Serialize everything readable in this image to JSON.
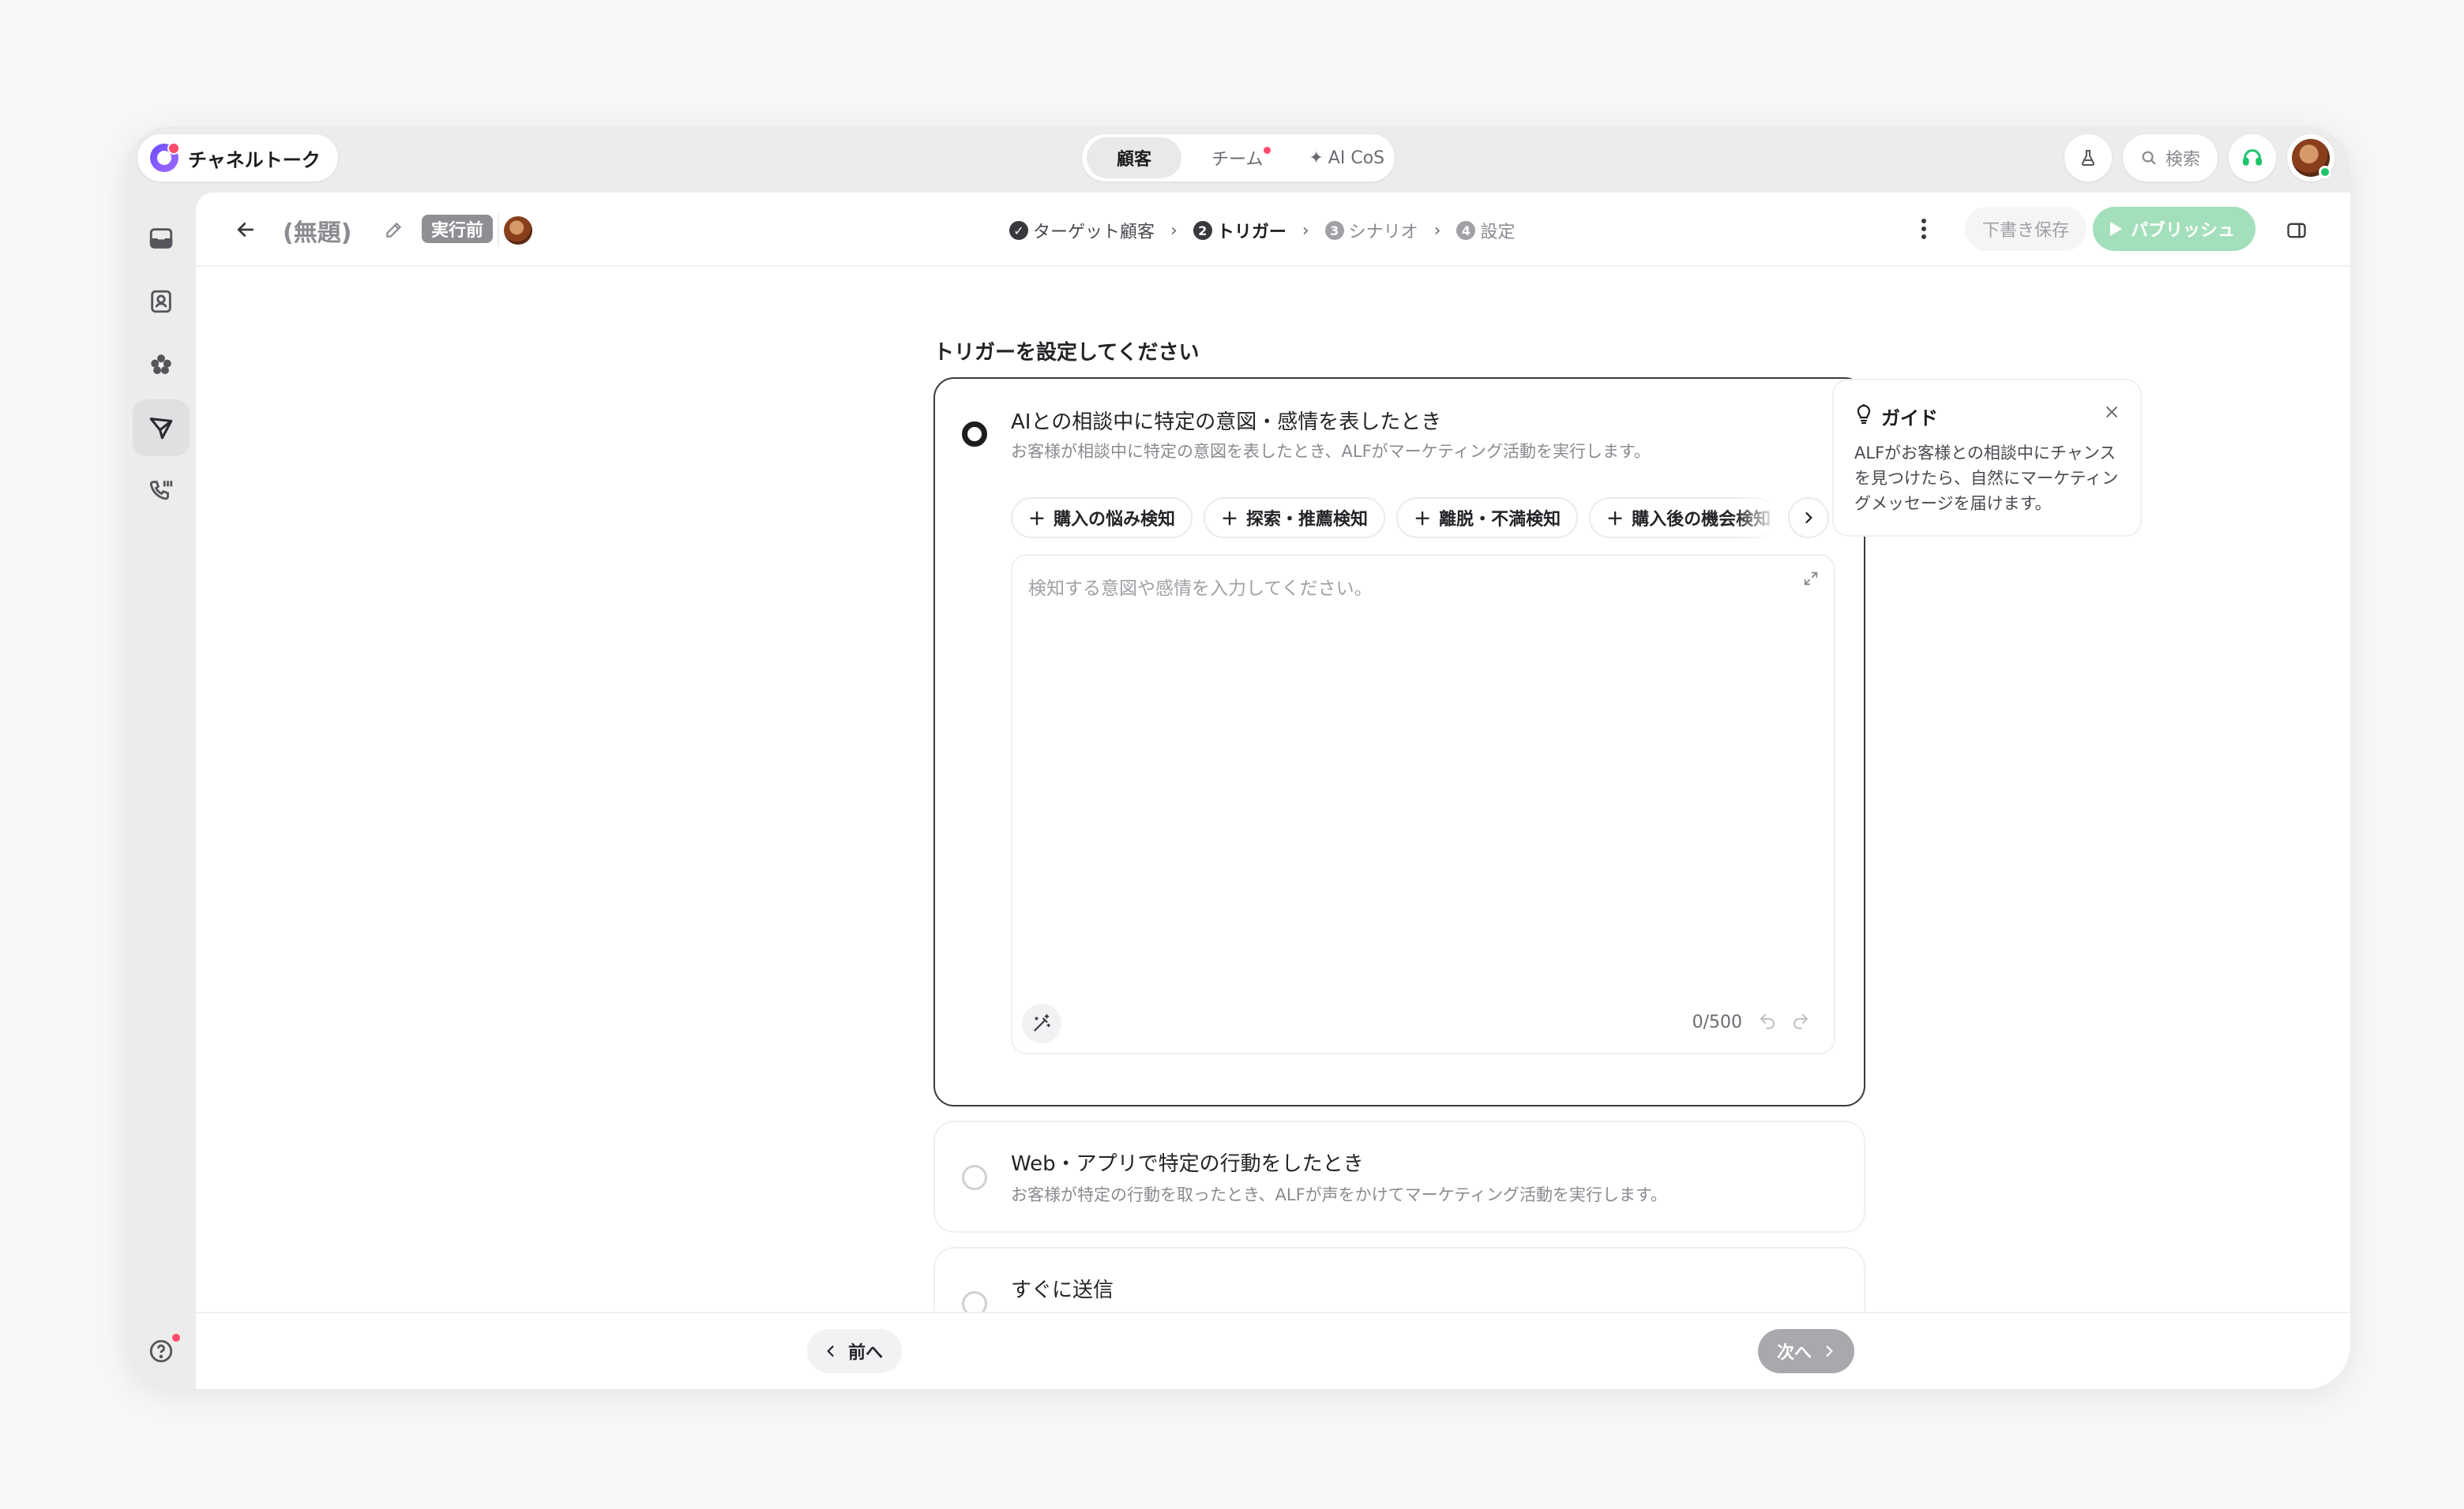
{
  "app": {
    "name": "チャネルトーク"
  },
  "top_tabs": [
    {
      "label": "顧客",
      "active": true,
      "dot": false
    },
    {
      "label": "チーム",
      "active": false,
      "dot": true
    },
    {
      "label": "AI CoS",
      "active": false,
      "dot": false
    }
  ],
  "top_right": {
    "search_label": "検索"
  },
  "header": {
    "title": "(無題)",
    "status_badge": "実行前",
    "steps": [
      {
        "num": "✓",
        "label": "ターゲット顧客",
        "state": "done"
      },
      {
        "num": "2",
        "label": "トリガー",
        "state": "active"
      },
      {
        "num": "3",
        "label": "シナリオ",
        "state": "upcoming"
      },
      {
        "num": "4",
        "label": "設定",
        "state": "upcoming"
      }
    ],
    "draft_label": "下書き保存",
    "publish_label": "パブリッシュ"
  },
  "main": {
    "section_title": "トリガーを設定してください",
    "options": [
      {
        "title": "AIとの相談中に特定の意図・感情を表したとき",
        "desc": "お客様が相談中に特定の意図を表したとき、ALFがマーケティング活動を実行します。",
        "selected": true
      },
      {
        "title": "Web・アプリで特定の行動をしたとき",
        "desc": "お客様が特定の行動を取ったとき、ALFが声をかけてマーケティング活動を実行します。",
        "selected": false
      },
      {
        "title": "すぐに送信",
        "desc": "",
        "selected": false
      }
    ],
    "chips": [
      "購入の悩み検知",
      "探索・推薦検知",
      "離脱・不満検知",
      "購入後の機会検知"
    ],
    "textarea": {
      "placeholder": "検知する意図や感情を入力してください。",
      "counter": "0/500"
    }
  },
  "guide": {
    "title": "ガイド",
    "text": "ALFがお客様との相談中にチャンスを見つけたら、自然にマーケティングメッセージを届けます。"
  },
  "footer": {
    "prev_label": "前へ",
    "next_label": "次へ"
  },
  "colors": {
    "accent": "#6b4dff",
    "publish": "#a4dfbc",
    "notification": "#ff4a6a",
    "online": "#1fc46a"
  }
}
